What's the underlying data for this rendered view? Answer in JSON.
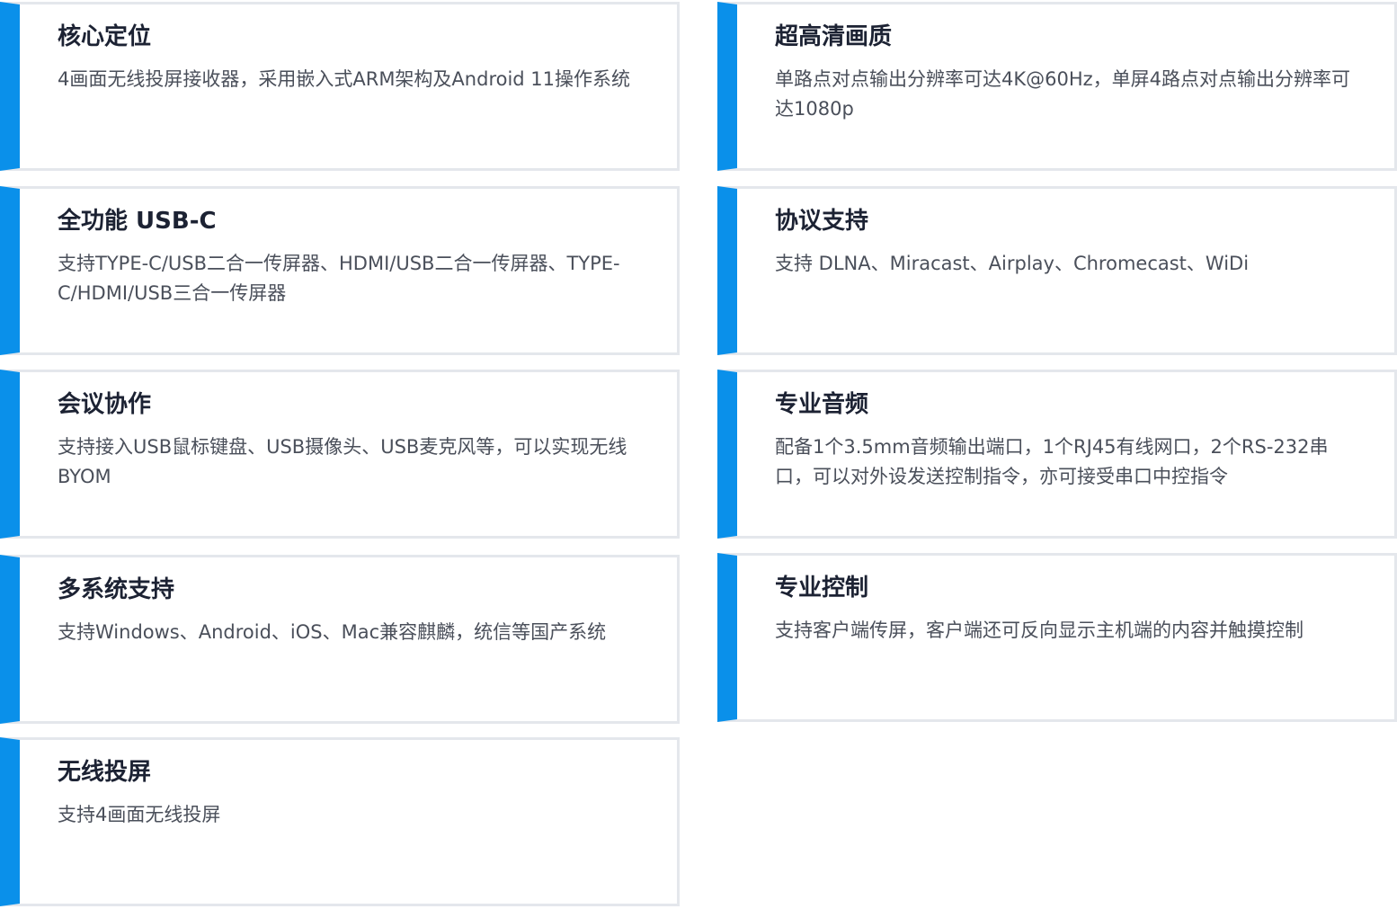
{
  "colors": {
    "accent": "#0a90ea",
    "border": "#e4e7ec",
    "title": "#1c2233",
    "text": "#4a4f5a"
  },
  "features": [
    {
      "title": "核心定位",
      "description": "4画面无线投屏接收器，采用嵌入式ARM架构及Android 11操作系统"
    },
    {
      "title": "超高清画质",
      "description": "单路点对点输出分辨率可达4K@60Hz，单屏4路点对点输出分辨率可达1080p"
    },
    {
      "title": "全功能 USB-C",
      "description": "支持TYPE-C/USB二合一传屏器、HDMI/USB二合一传屏器、TYPE-C/HDMI/USB三合一传屏器"
    },
    {
      "title": "协议支持",
      "description": "支持 DLNA、Miracast、Airplay、Chromecast、WiDi"
    },
    {
      "title": "会议协作",
      "description": "支持接入USB鼠标键盘、USB摄像头、USB麦克风等，可以实现无线BYOM"
    },
    {
      "title": "专业音频",
      "description": "配备1个3.5mm音频输出端口，1个RJ45有线网口，2个RS-232串口，可以对外设发送控制指令，亦可接受串口中控指令"
    },
    {
      "title": "多系统支持",
      "description": "支持Windows、Android、iOS、Mac兼容麒麟，统信等国产系统"
    },
    {
      "title": "专业控制",
      "description": "支持客户端传屏，客户端还可反向显示主机端的内容并触摸控制"
    },
    {
      "title": "无线投屏",
      "description": "支持4画面无线投屏"
    }
  ]
}
